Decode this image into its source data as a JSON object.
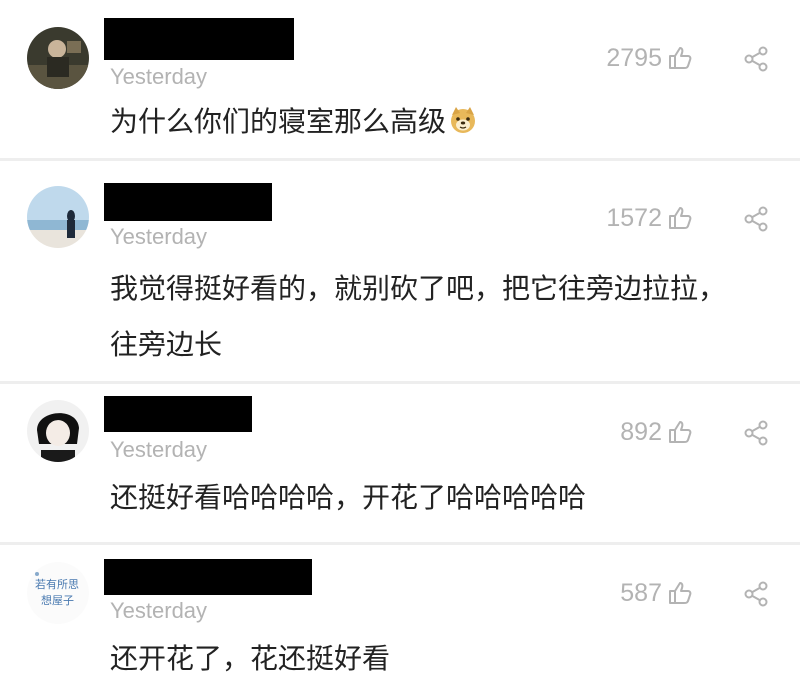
{
  "comments": [
    {
      "time": "Yesterday",
      "likes": "2795",
      "text": "为什么你们的寝室那么高级",
      "emoji": "dog-face-emoji"
    },
    {
      "time": "Yesterday",
      "likes": "1572",
      "text_line1": "我觉得挺好看的，就别砍了吧，把它往旁边拉拉，",
      "text_line2": "往旁边长"
    },
    {
      "time": "Yesterday",
      "likes": "892",
      "text": "还挺好看哈哈哈哈，开花了哈哈哈哈哈"
    },
    {
      "time": "Yesterday",
      "likes": "587",
      "text": "还开花了，花还挺好看"
    }
  ],
  "icons": {
    "like": "thumbs-up-icon",
    "share": "share-icon"
  },
  "colors": {
    "background": "#f5f5f5",
    "card": "#ffffff",
    "meta_text": "#b3b3b3",
    "body_text": "#222222",
    "redaction": "#000000"
  }
}
